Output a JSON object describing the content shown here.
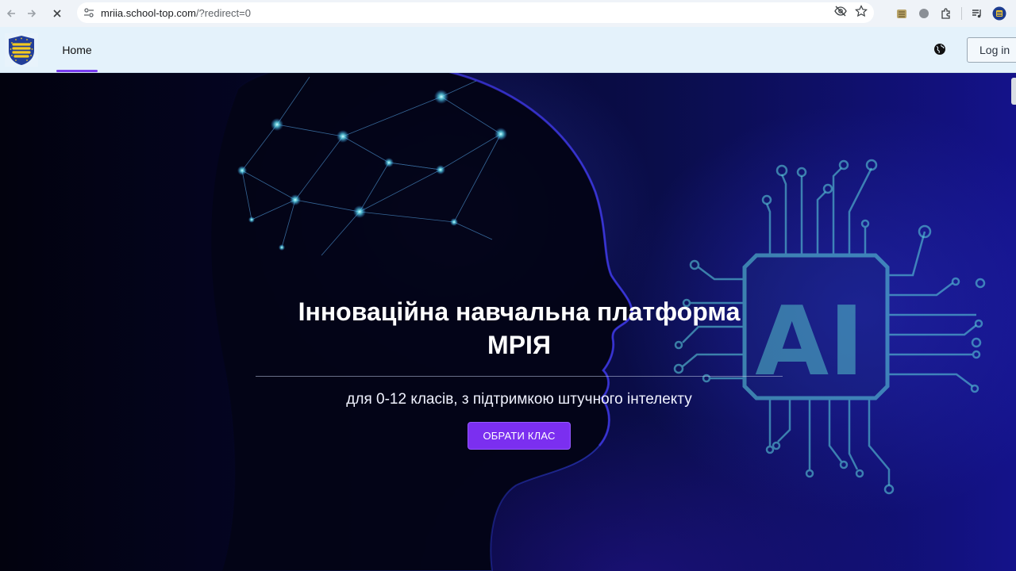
{
  "browser": {
    "url_host": "mriia.school-top.com",
    "url_path": "/?redirect=0",
    "icons": [
      "back-icon",
      "forward-icon",
      "stop-icon",
      "site-info-icon",
      "eye-off-icon",
      "star-icon",
      "extension-icon",
      "puzzle-icon",
      "media-icon",
      "profile-icon"
    ]
  },
  "header": {
    "nav_home": "Home",
    "login_label": "Log in",
    "accent": "#7a3df0"
  },
  "hero": {
    "title_line1": "Інноваційна навчальна платформа",
    "title_line2": "МРІЯ",
    "subtitle": "для 0-12 класів, з підтримкою штучного інтелекту",
    "cta_label": "ОБРАТИ КЛАС",
    "ai_label": "AI",
    "cta_color": "#7b2ff0"
  }
}
